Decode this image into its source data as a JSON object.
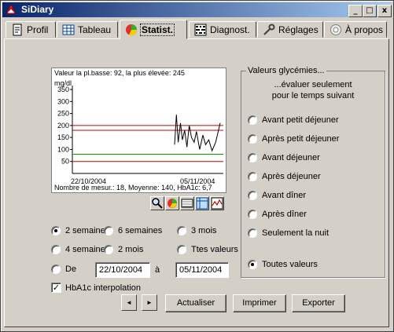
{
  "window": {
    "title": "SiDiary",
    "minimize": "_",
    "maximize": "□",
    "close": "x"
  },
  "tabs": [
    {
      "label": "Profil",
      "icon": "profile-icon"
    },
    {
      "label": "Tableau",
      "icon": "table-icon"
    },
    {
      "label": "Statist.",
      "icon": "statistics-icon",
      "active": true
    },
    {
      "label": "Diagnost.",
      "icon": "diagnostics-icon"
    },
    {
      "label": "Réglages",
      "icon": "settings-icon"
    },
    {
      "label": "À propos",
      "icon": "about-icon"
    }
  ],
  "chart": {
    "header": "Valeur la pl.basse: 92, la plus élevée: 245",
    "unit": "mg/dl",
    "footer": "Nombre de mesur.: 18, Moyenne: 140, HbA1c: 6,7",
    "x_start": "22/10/2004",
    "x_end": "05/11/2004"
  },
  "chart_data": {
    "type": "line",
    "ylabel": "mg/dl",
    "ylim": [
      0,
      350
    ],
    "yticks": [
      350,
      300,
      250,
      200,
      150,
      100,
      50
    ],
    "x": [
      "22/10/2004",
      "05/11/2004"
    ],
    "reference_lines": [
      {
        "value": 200,
        "color": "#c00000"
      },
      {
        "value": 180,
        "color": "#c00000"
      },
      {
        "value": 80,
        "color": "#00a000"
      },
      {
        "value": 50,
        "color": "#c00000"
      }
    ],
    "series": [
      {
        "color": "#000000",
        "x_fraction": [
          0.0,
          0.04,
          0.08,
          0.13,
          0.17,
          0.22,
          0.27,
          0.32,
          0.37,
          0.43,
          0.48,
          0.55,
          0.62,
          0.68,
          0.75,
          0.82,
          0.9,
          1.0
        ],
        "values": [
          120,
          245,
          130,
          210,
          140,
          180,
          110,
          200,
          150,
          130,
          175,
          100,
          160,
          120,
          140,
          95,
          130,
          210
        ]
      }
    ]
  },
  "chart_buttons": [
    "zoom-icon",
    "pie-icon",
    "grid-icon",
    "table-view-icon",
    "graph-icon"
  ],
  "period": {
    "options": [
      {
        "label": "2 semaines",
        "checked": true
      },
      {
        "label": "6 semaines",
        "checked": false
      },
      {
        "label": "3 mois",
        "checked": false
      },
      {
        "label": "4 semaines",
        "checked": false
      },
      {
        "label": "2 mois",
        "checked": false
      },
      {
        "label": "Ttes valeurs",
        "checked": false
      }
    ],
    "custom_label": "De",
    "from": "22/10/2004",
    "to_label": "à",
    "to": "05/11/2004"
  },
  "hba1c": {
    "label": "HbA1c interpolation",
    "checked": true
  },
  "values_group": {
    "title": "Valeurs glycémies...",
    "subtitle_1": "...évaluer seulement",
    "subtitle_2": "pour le temps suivant",
    "options": [
      {
        "label": "Avant petit déjeuner",
        "checked": false
      },
      {
        "label": "Après petit déjeuner",
        "checked": false
      },
      {
        "label": "Avant déjeuner",
        "checked": false
      },
      {
        "label": "Après déjeuner",
        "checked": false
      },
      {
        "label": "Avant dîner",
        "checked": false
      },
      {
        "label": "Après dîner",
        "checked": false
      },
      {
        "label": "Seulement la nuit",
        "checked": false
      },
      {
        "label": "Toutes valeurs",
        "checked": true
      }
    ]
  },
  "buttons": {
    "prev": "◄",
    "next": "►",
    "update": "Actualiser",
    "print": "Imprimer",
    "export": "Exporter"
  }
}
